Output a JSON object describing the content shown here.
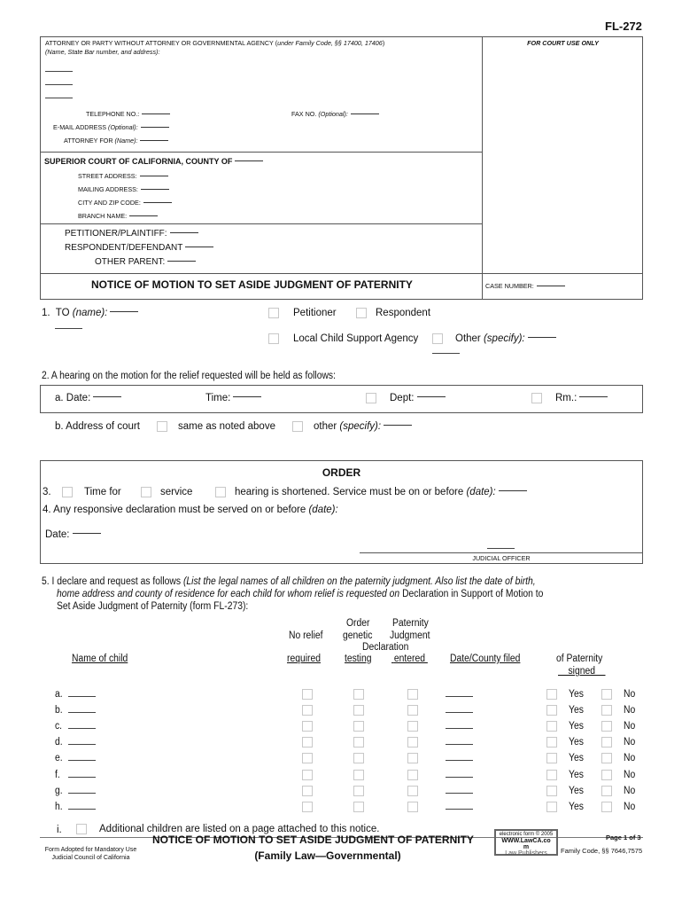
{
  "form_id": "FL-272",
  "header": {
    "attorney_heading": "ATTORNEY OR PARTY WITHOUT ATTORNEY OR GOVERNMENTAL AGENCY (",
    "attorney_heading_italic": "under Family Code, §§ 17400, 17406",
    "attorney_heading_close": ")",
    "attorney_subheading": "(Name, State Bar number, and address):",
    "telephone_label": "TELEPHONE NO.:",
    "fax_label": "FAX NO.",
    "fax_optional": "(Optional):",
    "email_label": "E-MAIL ADDRESS",
    "email_optional": "(Optional):",
    "attorney_for_label": "ATTORNEY FOR",
    "attorney_for_name": "(Name):",
    "court_use_only": "FOR COURT USE ONLY",
    "court_heading": "SUPERIOR COURT OF CALIFORNIA, COUNTY OF",
    "street_address": "STREET ADDRESS:",
    "mailing_address": "MAILING ADDRESS:",
    "city_zip": "CITY AND ZIP CODE:",
    "branch_name": "BRANCH NAME:",
    "petitioner": "PETITIONER/PLAINTIFF:",
    "respondent": "RESPONDENT/DEFENDANT",
    "other_parent": "OTHER PARENT:",
    "title": "NOTICE OF MOTION TO SET ASIDE JUDGMENT OF PATERNITY",
    "case_number": "CASE NUMBER:"
  },
  "item1": {
    "number": "1.",
    "to_label": "TO",
    "to_italic": "(name):",
    "petitioner": "Petitioner",
    "respondent": "Respondent",
    "lcsa": "Local Child Support Agency",
    "other": "Other",
    "other_italic": "(specify):"
  },
  "item2": {
    "text": "2.   A hearing on the motion for the relief requested will be held as follows:",
    "date_label": "a.  Date:",
    "time_label": "Time:",
    "dept_label": "Dept:",
    "rm_label": "Rm.:",
    "address_label": "b.  Address of court",
    "same_as_above": "same as noted above",
    "other": "other",
    "other_italic": "(specify):"
  },
  "order": {
    "heading": "ORDER",
    "item3_number": "3.",
    "time_for": "Time for",
    "service": "service",
    "hearing_shortened": "hearing is shortened. Service must be on or before",
    "date_italic": "(date):",
    "item4": "4.   Any responsive declaration must be served on or before",
    "item4_italic": "(date):",
    "date_label": "Date:",
    "judicial_officer": "JUDICIAL OFFICER"
  },
  "item5": {
    "line1_plain": "5.  I declare and request as follows ",
    "line1_italic": "(List the legal names of all children on the paternity judgment.  Also list the date of birth,",
    "line2_italic": "home address and county of residence for each child for whom relief is requested on ",
    "line2_plain": "Declaration in Support of Motion to",
    "line3_plain": "Set Aside Judgment of Paternity (form FL-273):",
    "columns": {
      "name_of_child": "Name of child",
      "no_relief_top": "No relief",
      "no_relief_bottom": "required",
      "order_top": "Order",
      "order_mid": "genetic",
      "order_bottom": "testing",
      "paternity_top": "Paternity",
      "paternity_mid": "Judgment",
      "declaration": "Declaration",
      "paternity_bottom": "entered",
      "date_county": "Date/County filed",
      "of_paternity": "of Paternity",
      "signed": "signed"
    },
    "rows": [
      {
        "letter": "a."
      },
      {
        "letter": "b."
      },
      {
        "letter": "c."
      },
      {
        "letter": "d."
      },
      {
        "letter": "e."
      },
      {
        "letter": "f."
      },
      {
        "letter": "g."
      },
      {
        "letter": "h."
      }
    ],
    "yes": "Yes",
    "no": "No",
    "additional_letter": "i.",
    "additional_text": "Additional children are listed on a page attached to this notice."
  },
  "footer": {
    "adopted_line1": "Form Adopted for Mandatory Use",
    "adopted_line2": "Judicial Council of California",
    "title": "NOTICE OF MOTION TO SET ASIDE JUDGMENT OF PATERNITY",
    "subtitle": "(Family Law—Governmental)",
    "stamp_line1": "electronic form © 2005",
    "stamp_line2": "WWW.LawCA.co",
    "stamp_line3": "m",
    "stamp_line4": "Law Publishers",
    "page": "Page 1 of 3",
    "code": "Family Code, §§ 7646,7575"
  }
}
